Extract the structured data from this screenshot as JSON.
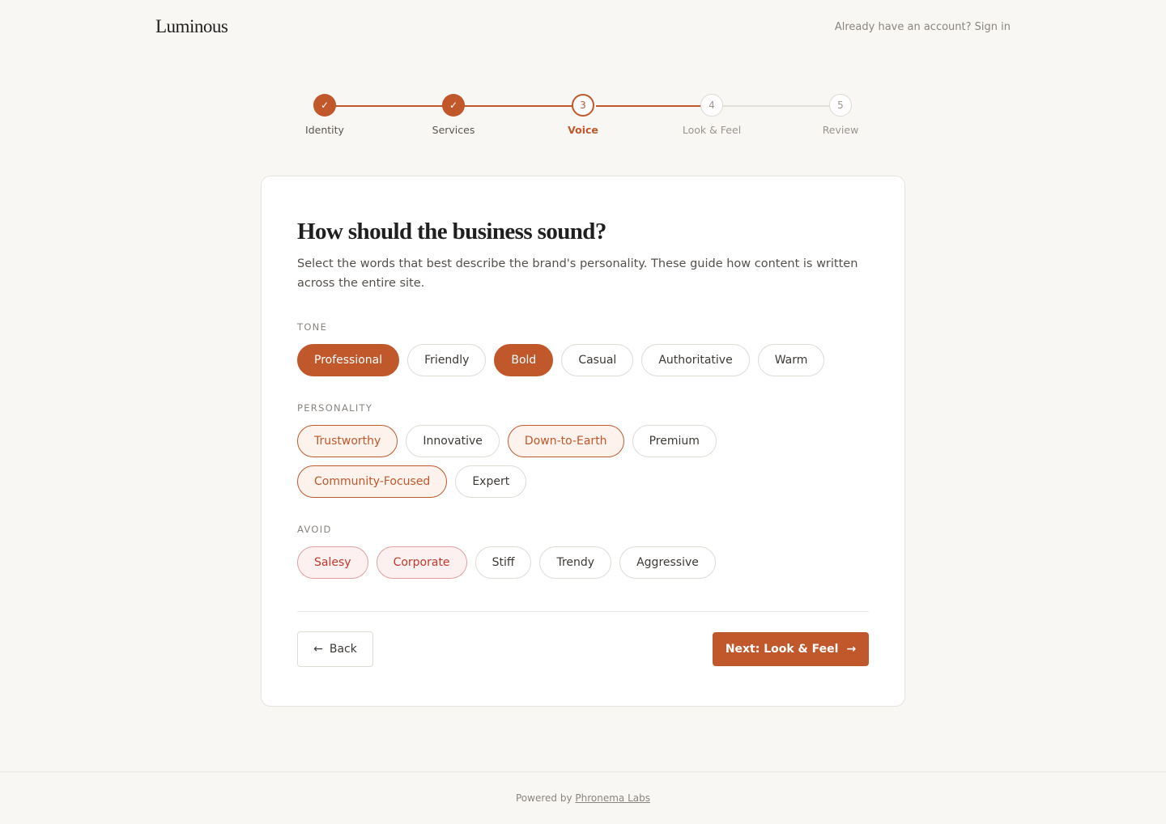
{
  "brand": {
    "logo": "Luminous",
    "signin_text": "Already have an account? Sign in"
  },
  "colors": {
    "accent": "#c0582c",
    "background": "#f9f7f3"
  },
  "stepper": {
    "steps": [
      {
        "number": "1",
        "label": "Identity",
        "state": "done",
        "glyph": "✓"
      },
      {
        "number": "2",
        "label": "Services",
        "state": "done",
        "glyph": "✓"
      },
      {
        "number": "3",
        "label": "Voice",
        "state": "active",
        "glyph": "3"
      },
      {
        "number": "4",
        "label": "Look & Feel",
        "state": "todo",
        "glyph": "4"
      },
      {
        "number": "5",
        "label": "Review",
        "state": "todo",
        "glyph": "5"
      }
    ]
  },
  "card": {
    "title": "How should the business sound?",
    "description": "Select the words that best describe the brand's personality. These guide how content is written across the entire site."
  },
  "sections": {
    "tone": {
      "label": "TONE",
      "options": [
        {
          "label": "Professional",
          "selected": true
        },
        {
          "label": "Friendly",
          "selected": false
        },
        {
          "label": "Bold",
          "selected": true
        },
        {
          "label": "Casual",
          "selected": false
        },
        {
          "label": "Authoritative",
          "selected": false
        },
        {
          "label": "Warm",
          "selected": false
        }
      ]
    },
    "personality": {
      "label": "PERSONALITY",
      "options": [
        {
          "label": "Trustworthy",
          "selected": true
        },
        {
          "label": "Innovative",
          "selected": false
        },
        {
          "label": "Down-to-Earth",
          "selected": true
        },
        {
          "label": "Premium",
          "selected": false
        },
        {
          "label": "Community-Focused",
          "selected": true
        },
        {
          "label": "Expert",
          "selected": false
        }
      ]
    },
    "avoid": {
      "label": "AVOID",
      "options": [
        {
          "label": "Salesy",
          "selected": true
        },
        {
          "label": "Corporate",
          "selected": true
        },
        {
          "label": "Stiff",
          "selected": false
        },
        {
          "label": "Trendy",
          "selected": false
        },
        {
          "label": "Aggressive",
          "selected": false
        }
      ]
    }
  },
  "actions": {
    "back_label": "Back",
    "back_icon": "arrow-left-icon",
    "next_label": "Next: Look & Feel",
    "next_icon": "arrow-right-icon"
  },
  "footer": {
    "prefix": "Powered by",
    "link": "Phronema Labs"
  }
}
